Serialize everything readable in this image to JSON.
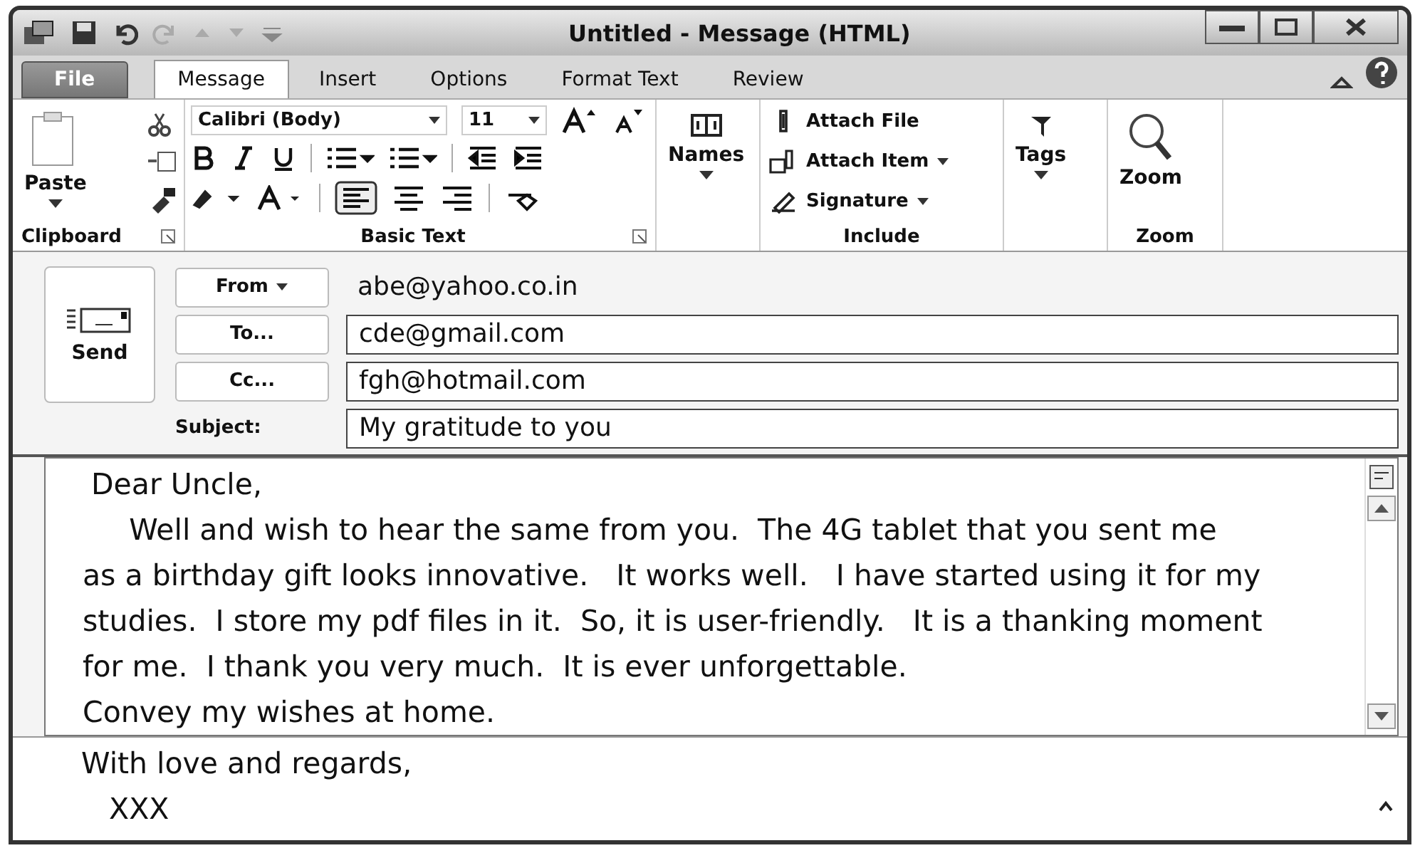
{
  "window": {
    "title": "Untitled - Message (HTML)"
  },
  "tabs": [
    {
      "label": "File",
      "kind": "file",
      "selected": false
    },
    {
      "label": "Message",
      "kind": "tab",
      "selected": true
    },
    {
      "label": "Insert",
      "kind": "tab",
      "selected": false
    },
    {
      "label": "Options",
      "kind": "tab",
      "selected": false
    },
    {
      "label": "Format Text",
      "kind": "tab",
      "selected": false
    },
    {
      "label": "Review",
      "kind": "tab",
      "selected": false
    }
  ],
  "ribbon": {
    "clipboard": {
      "paste": "Paste",
      "label": "Clipboard"
    },
    "basic_text": {
      "font": "Calibri (Body)",
      "size": "11",
      "label": "Basic Text"
    },
    "names": {
      "label": "Names"
    },
    "include": {
      "items": [
        "Attach File",
        "Attach Item",
        "Signature"
      ],
      "label": "Include"
    },
    "tags": {
      "label": "Tags"
    },
    "zoom": {
      "button": "Zoom",
      "label": "Zoom"
    }
  },
  "header": {
    "send": "Send",
    "from": {
      "label": "From",
      "value": "abe@yahoo.co.in"
    },
    "to": {
      "label": "To...",
      "value": "cde@gmail.com"
    },
    "cc": {
      "label": "Cc...",
      "value": "fgh@hotmail.com"
    },
    "subject": {
      "label": "Subject:",
      "value": "My gratitude to you"
    }
  },
  "body": {
    "lines": [
      "Dear Uncle,",
      "     Well and wish to hear the same from you.  The 4G tablet that you sent me",
      "as a birthday gift looks innovative.   It works well.   I have started using it for my",
      "studies.  I store my pdf files in it.  So, it is user-friendly.   It is a thanking moment",
      "for me.  I thank you very much.  It is ever unforgettable.",
      "Convey my wishes at home."
    ]
  },
  "footer": {
    "lines": [
      "With love and regards,",
      "   XXX"
    ]
  }
}
